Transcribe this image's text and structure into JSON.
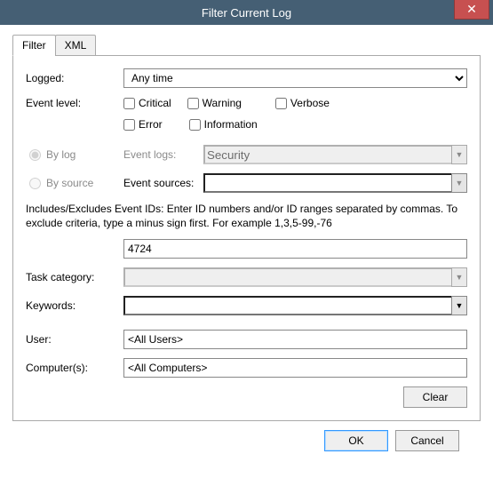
{
  "title": "Filter Current Log",
  "tabs": {
    "filter": "Filter",
    "xml": "XML"
  },
  "labels": {
    "logged": "Logged:",
    "event_level": "Event level:",
    "by_log": "By log",
    "by_source": "By source",
    "event_logs": "Event logs:",
    "event_sources": "Event sources:",
    "task_category": "Task category:",
    "keywords": "Keywords:",
    "user": "User:",
    "computers": "Computer(s):"
  },
  "logged_select": "Any time",
  "level": {
    "critical": "Critical",
    "warning": "Warning",
    "verbose": "Verbose",
    "error": "Error",
    "information": "Information"
  },
  "event_logs_value": "Security",
  "event_sources_value": "",
  "help_text": "Includes/Excludes Event IDs: Enter ID numbers and/or ID ranges separated by commas. To exclude criteria, type a minus sign first. For example 1,3,5-99,-76",
  "event_id_value": "4724",
  "task_category_value": "",
  "keywords_value": "",
  "user_value": "<All Users>",
  "computers_value": "<All Computers>",
  "buttons": {
    "clear": "Clear",
    "ok": "OK",
    "cancel": "Cancel"
  }
}
